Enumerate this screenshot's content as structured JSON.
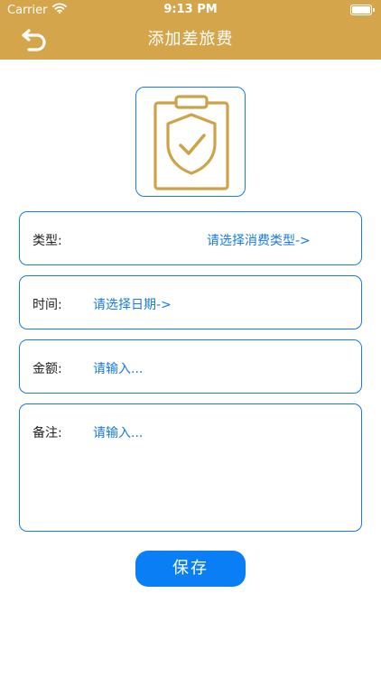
{
  "status_bar": {
    "carrier": "Carrier",
    "time": "9:13 PM",
    "wifi_icon": "wifi-icon",
    "battery_icon": "battery-icon"
  },
  "nav": {
    "title": "添加差旅费",
    "back_icon": "back-arrow-icon"
  },
  "logo": {
    "icon": "clipboard-shield-check-icon"
  },
  "form": {
    "type": {
      "label": "类型:",
      "value": "请选择消费类型->"
    },
    "time": {
      "label": "时间:",
      "value": "请选择日期->"
    },
    "amount": {
      "label": "金额:",
      "placeholder": "请输入..."
    },
    "note": {
      "label": "备注:",
      "placeholder": "请输入..."
    }
  },
  "save_button": {
    "label": "保存"
  },
  "colors": {
    "header_gold": "#d4a54a",
    "border_blue": "#1a7be0",
    "button_blue": "#0a7ff5",
    "icon_gold": "#d0a247"
  }
}
